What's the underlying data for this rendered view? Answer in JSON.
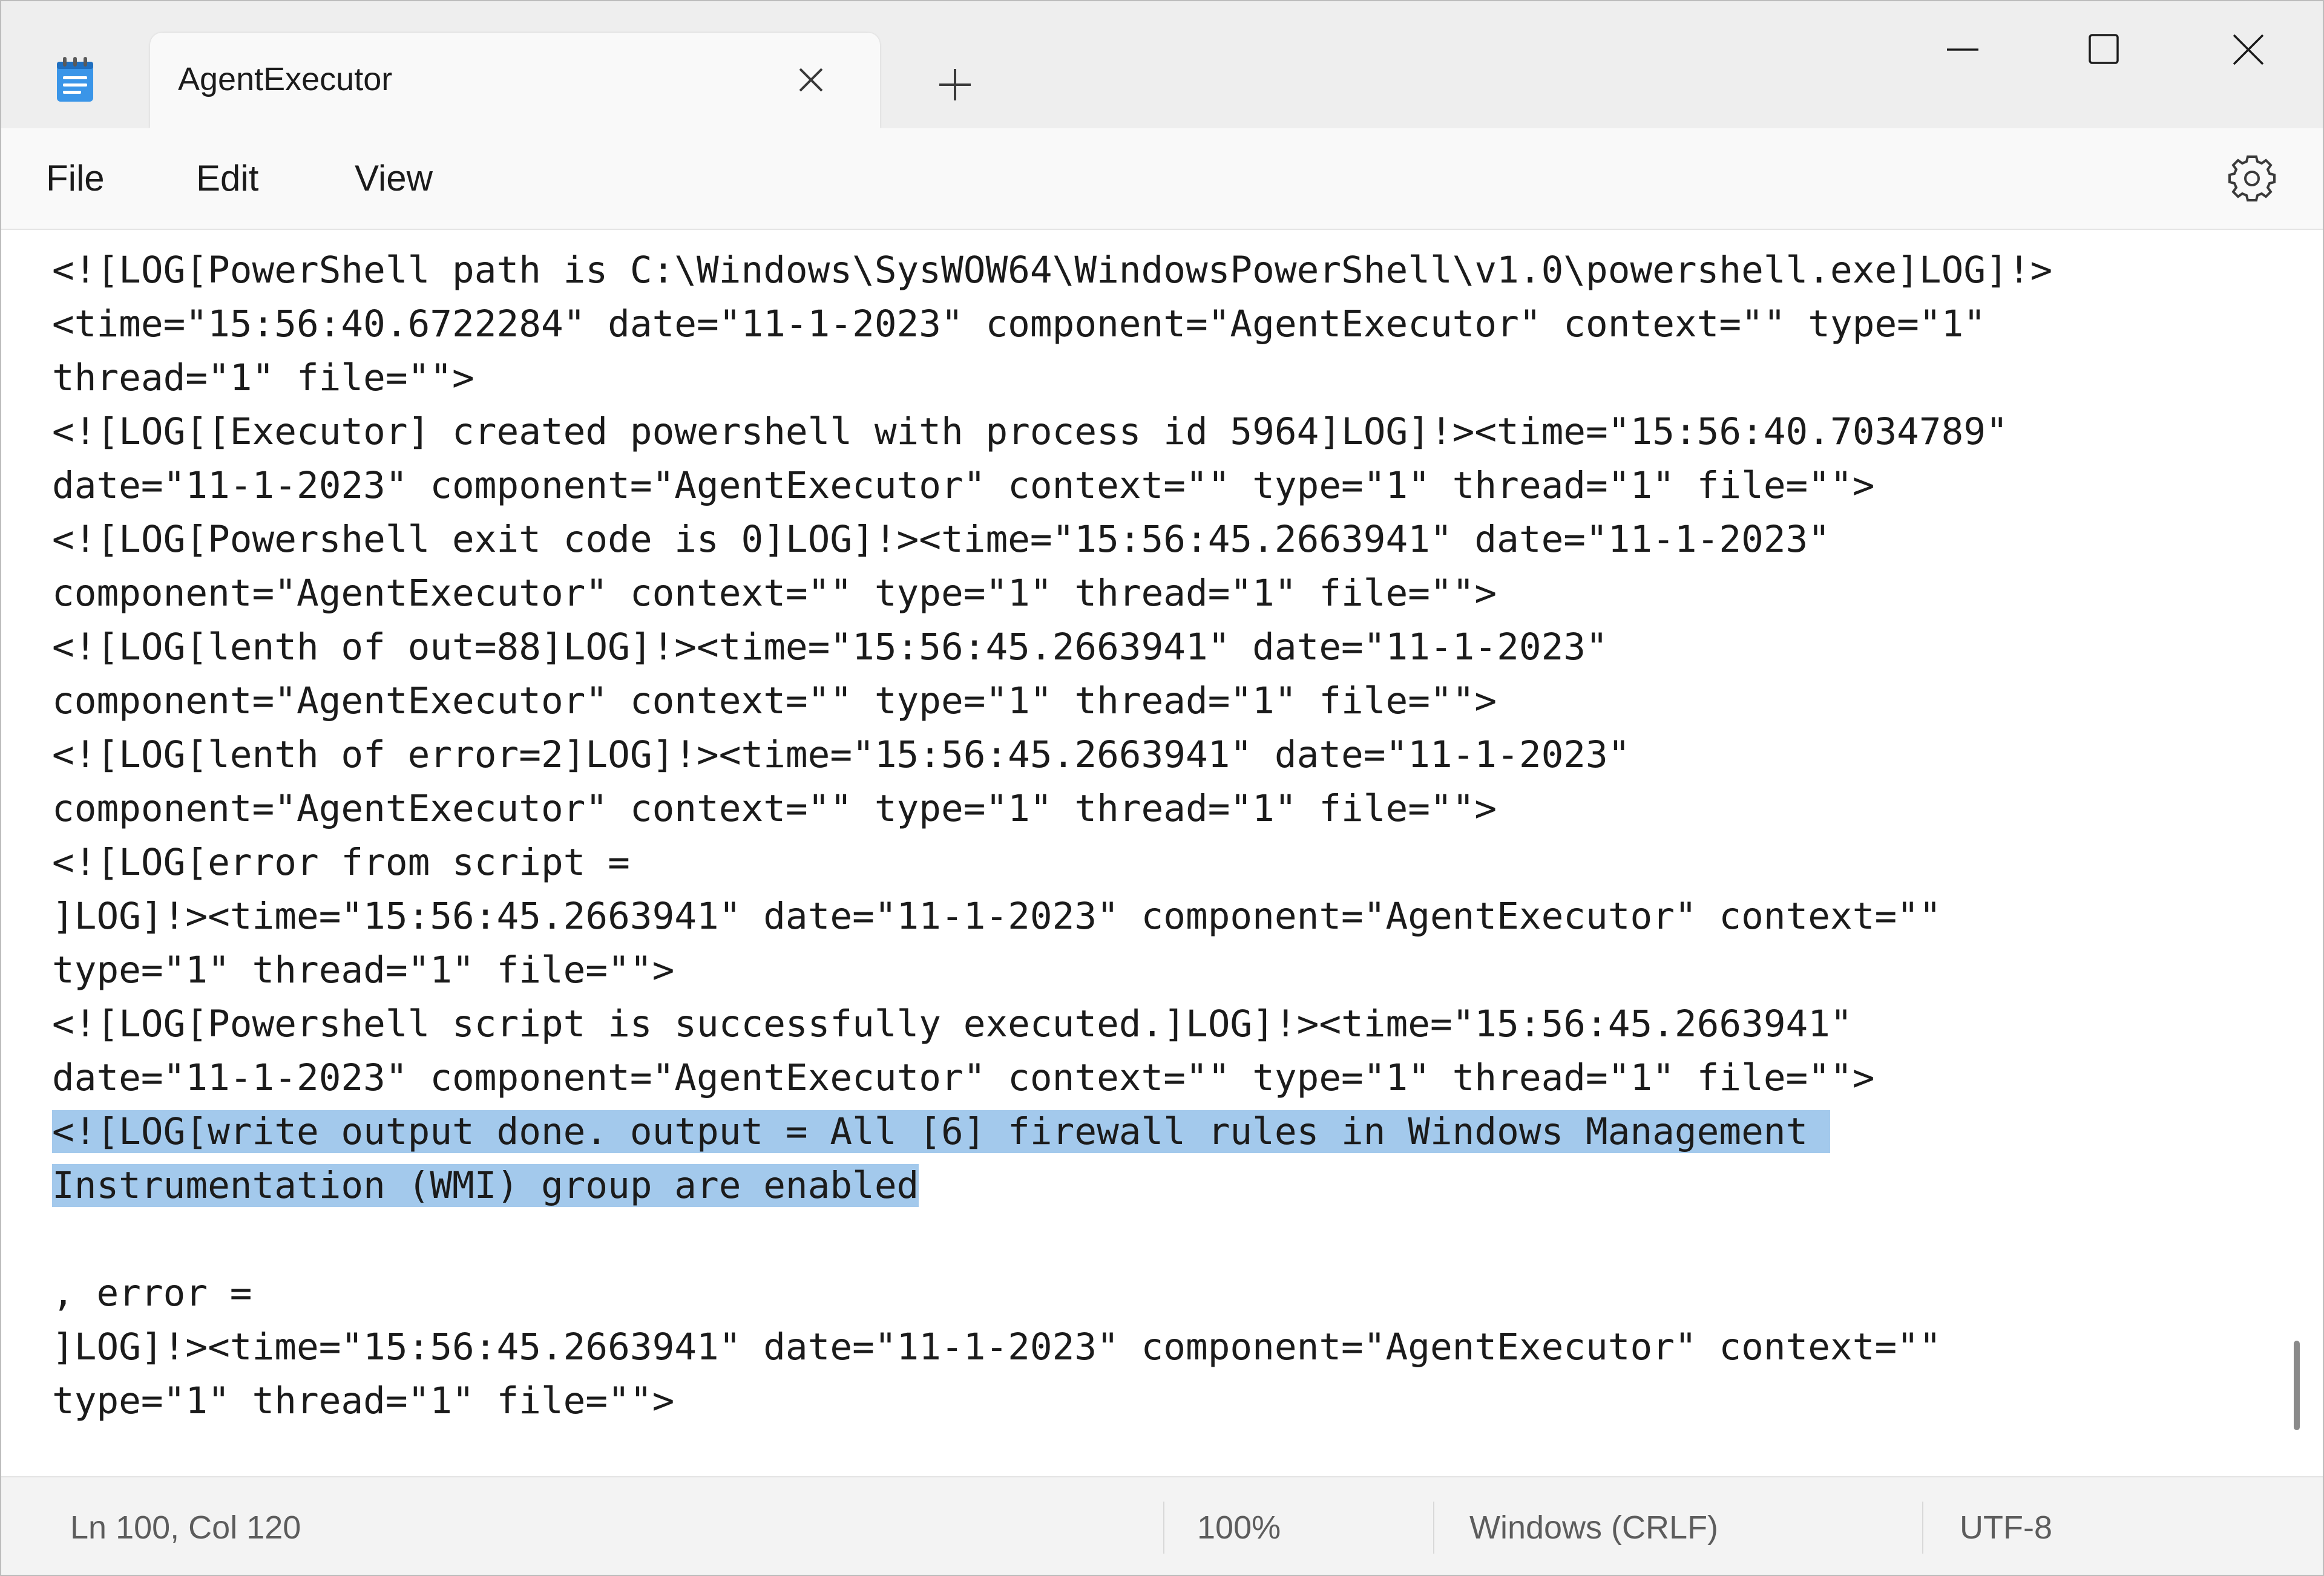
{
  "window": {
    "tab_title": "AgentExecutor"
  },
  "icons": {
    "app": "notepad-icon",
    "tab_close": "close-icon",
    "new_tab": "plus-icon",
    "minimize": "minimize-icon",
    "maximize": "maximize-icon",
    "close": "close-icon",
    "settings": "gear-icon"
  },
  "menu": {
    "file": "File",
    "edit": "Edit",
    "view": "View"
  },
  "editor": {
    "lines_before_selection": [
      "<![LOG[PowerShell path is C:\\Windows\\SysWOW64\\WindowsPowerShell\\v1.0\\powershell.exe]LOG]!>",
      "<time=\"15:56:40.6722284\" date=\"11-1-2023\" component=\"AgentExecutor\" context=\"\" type=\"1\"",
      "thread=\"1\" file=\"\">",
      "<![LOG[[Executor] created powershell with process id 5964]LOG]!><time=\"15:56:40.7034789\"",
      "date=\"11-1-2023\" component=\"AgentExecutor\" context=\"\" type=\"1\" thread=\"1\" file=\"\">",
      "<![LOG[Powershell exit code is 0]LOG]!><time=\"15:56:45.2663941\" date=\"11-1-2023\"",
      "component=\"AgentExecutor\" context=\"\" type=\"1\" thread=\"1\" file=\"\">",
      "<![LOG[lenth of out=88]LOG]!><time=\"15:56:45.2663941\" date=\"11-1-2023\"",
      "component=\"AgentExecutor\" context=\"\" type=\"1\" thread=\"1\" file=\"\">",
      "<![LOG[lenth of error=2]LOG]!><time=\"15:56:45.2663941\" date=\"11-1-2023\"",
      "component=\"AgentExecutor\" context=\"\" type=\"1\" thread=\"1\" file=\"\">",
      "<![LOG[error from script =",
      "]LOG]!><time=\"15:56:45.2663941\" date=\"11-1-2023\" component=\"AgentExecutor\" context=\"\"",
      "type=\"1\" thread=\"1\" file=\"\">",
      "<![LOG[Powershell script is successfully executed.]LOG]!><time=\"15:56:45.2663941\"",
      "date=\"11-1-2023\" component=\"AgentExecutor\" context=\"\" type=\"1\" thread=\"1\" file=\"\">"
    ],
    "selected_lines": [
      "<![LOG[write output done. output = All [6] firewall rules in Windows Management ",
      "Instrumentation (WMI) group are enabled"
    ],
    "lines_after_selection": [
      "",
      ", error =",
      "]LOG]!><time=\"15:56:45.2663941\" date=\"11-1-2023\" component=\"AgentExecutor\" context=\"\"",
      "type=\"1\" thread=\"1\" file=\"\">"
    ]
  },
  "status": {
    "position": "Ln 100, Col 120",
    "zoom": "100%",
    "line_ending": "Windows (CRLF)",
    "encoding": "UTF-8"
  },
  "colors": {
    "selection": "#a3c9ec",
    "titlebar": "#eeeeee",
    "app_icon": "#2a8be0"
  }
}
